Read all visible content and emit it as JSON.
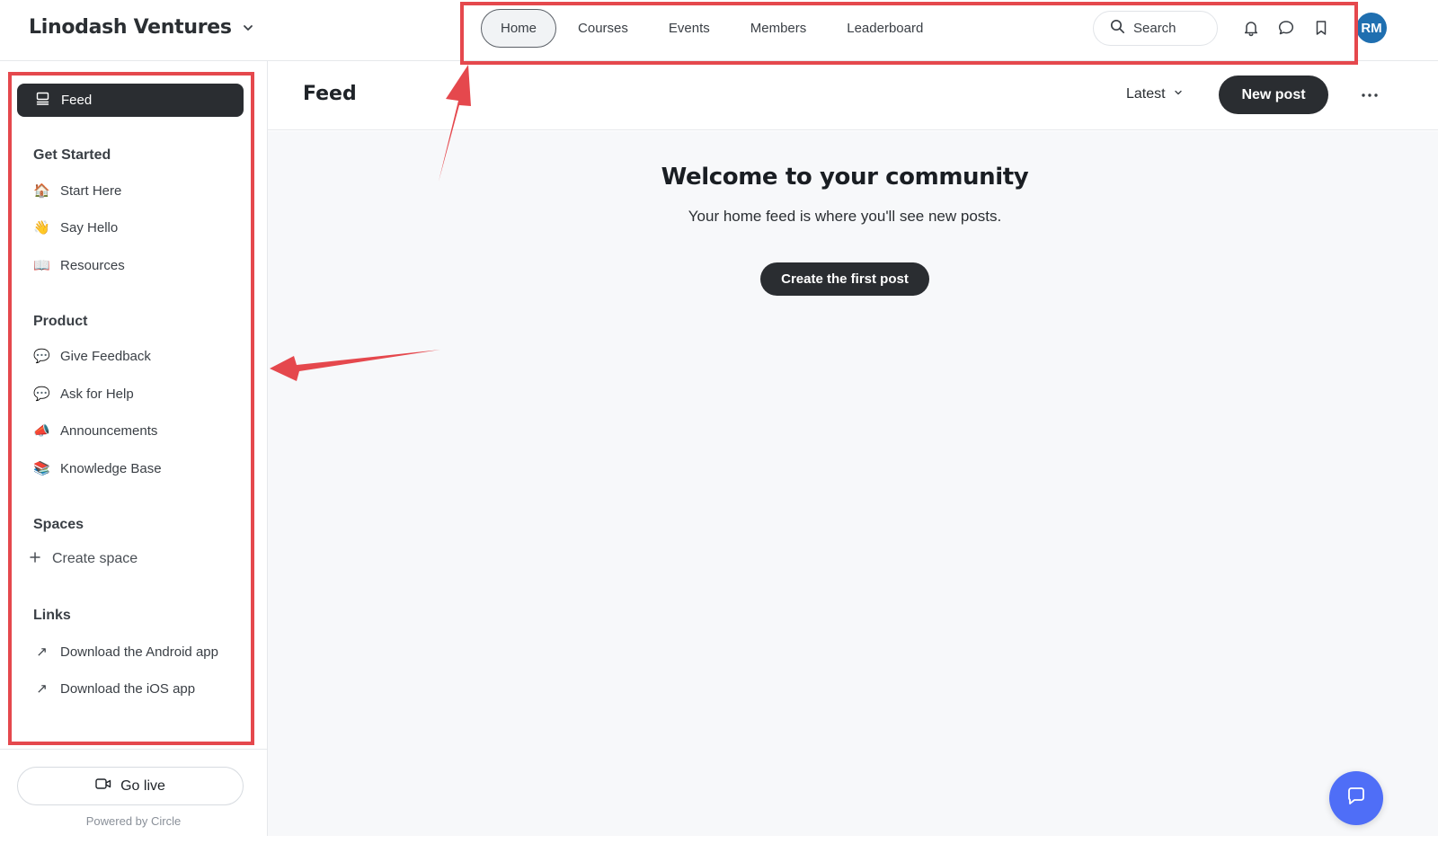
{
  "brand": {
    "name": "Linodash Ventures"
  },
  "nav": {
    "items": [
      {
        "label": "Home",
        "active": true
      },
      {
        "label": "Courses"
      },
      {
        "label": "Events"
      },
      {
        "label": "Members"
      },
      {
        "label": "Leaderboard"
      }
    ]
  },
  "search": {
    "label": "Search"
  },
  "header_icons": [
    "bell-icon",
    "chat-bubble-icon",
    "bookmark-icon"
  ],
  "user": {
    "initials": "RM"
  },
  "sidebar": {
    "feed_label": "Feed",
    "sections": [
      {
        "title": "Get Started",
        "items": [
          {
            "emoji": "🏠",
            "label": "Start Here"
          },
          {
            "emoji": "👋",
            "label": "Say Hello"
          },
          {
            "emoji": "📖",
            "label": "Resources"
          }
        ]
      },
      {
        "title": "Product",
        "items": [
          {
            "emoji": "💬",
            "label": "Give Feedback"
          },
          {
            "emoji": "💬",
            "label": "Ask for Help"
          },
          {
            "emoji": "📣",
            "label": "Announcements"
          },
          {
            "emoji": "📚",
            "label": "Knowledge Base"
          }
        ]
      },
      {
        "title": "Spaces",
        "create_label": "Create space"
      },
      {
        "title": "Links",
        "items": [
          {
            "emoji": "↗",
            "label": "Download the Android app"
          },
          {
            "emoji": "↗",
            "label": "Download the iOS app"
          }
        ]
      }
    ],
    "go_live_label": "Go live",
    "powered_by": "Powered by Circle"
  },
  "main": {
    "title": "Feed",
    "sort_label": "Latest",
    "new_post_label": "New post",
    "welcome_title": "Welcome to your community",
    "welcome_subtitle": "Your home feed is where you'll see new posts.",
    "create_first_label": "Create the first post"
  },
  "colors": {
    "annotation": "#e5484d",
    "dark_button": "#2a2d31",
    "avatar": "#1f6fb0",
    "chat_fab": "#4f6ef7",
    "content_bg": "#f7f8fa"
  }
}
